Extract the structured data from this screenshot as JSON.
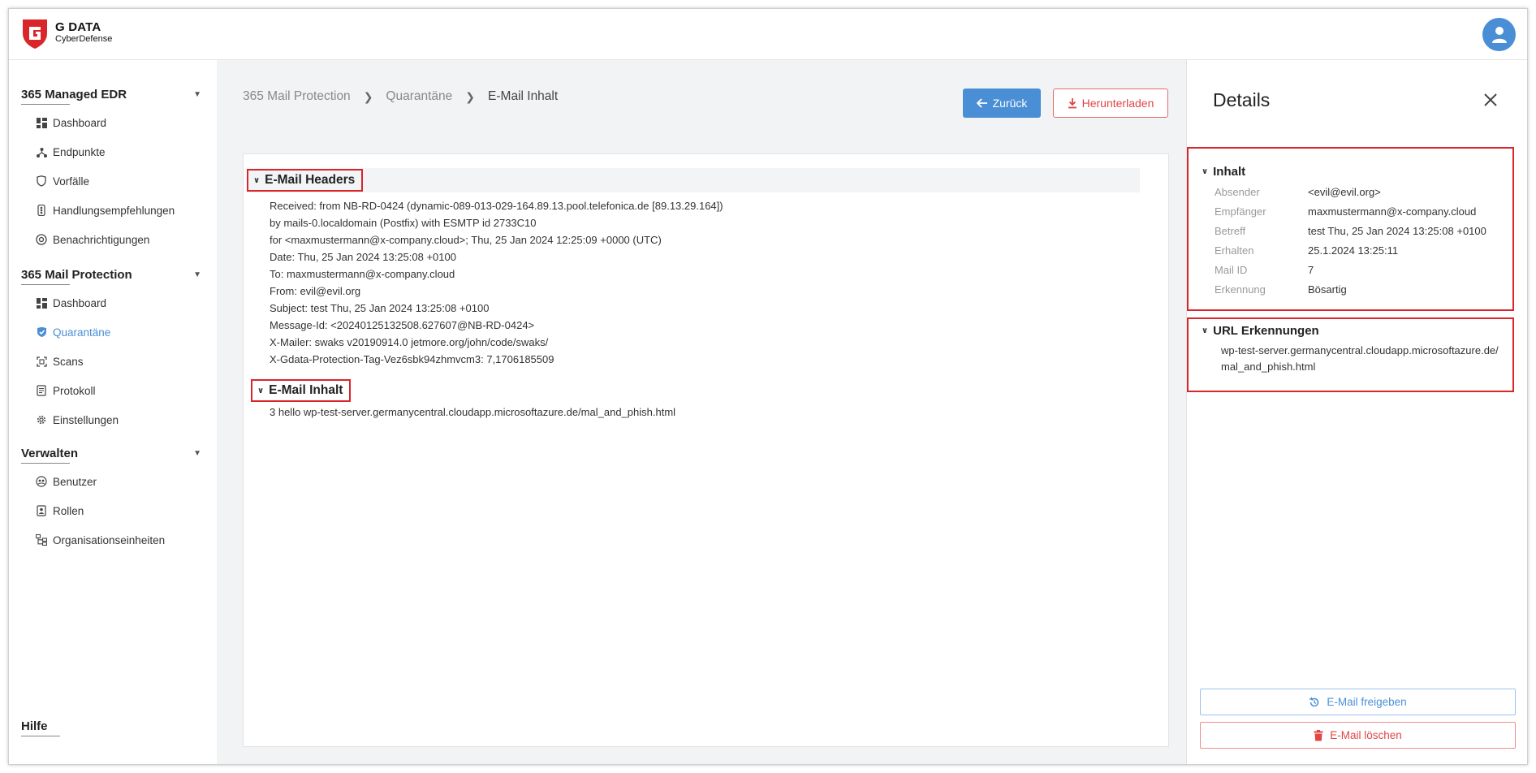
{
  "brand": {
    "name": "G DATA",
    "sub": "CyberDefense"
  },
  "sidebar": {
    "sections": [
      {
        "title": "365 Managed EDR",
        "items": [
          "Dashboard",
          "Endpunkte",
          "Vorfälle",
          "Handlungsempfehlungen",
          "Benachrichtigungen"
        ]
      },
      {
        "title": "365 Mail Protection",
        "items": [
          "Dashboard",
          "Quarantäne",
          "Scans",
          "Protokoll",
          "Einstellungen"
        ]
      },
      {
        "title": "Verwalten",
        "items": [
          "Benutzer",
          "Rollen",
          "Organisationseinheiten"
        ]
      }
    ],
    "active_item": "Quarantäne",
    "help": "Hilfe"
  },
  "breadcrumb": {
    "items": [
      "365 Mail Protection",
      "Quarantäne",
      "E-Mail Inhalt"
    ]
  },
  "actions": {
    "back": "Zurück",
    "download": "Herunterladen"
  },
  "email": {
    "headers_title": "E-Mail Headers",
    "headers": [
      "Received: from NB-RD-0424 (dynamic-089-013-029-164.89.13.pool.telefonica.de [89.13.29.164])",
      "by mails-0.localdomain (Postfix) with ESMTP id 2733C10",
      "for <maxmustermann@x-company.cloud>; Thu, 25 Jan 2024 12:25:09 +0000 (UTC)",
      "Date: Thu, 25 Jan 2024 13:25:08 +0100",
      "To: maxmustermann@x-company.cloud",
      "From: evil@evil.org",
      "Subject: test Thu, 25 Jan 2024 13:25:08 +0100",
      "Message-Id: <20240125132508.627607@NB-RD-0424>",
      "X-Mailer: swaks v20190914.0 jetmore.org/john/code/swaks/",
      "X-Gdata-Protection-Tag-Vez6sbk94zhmvcm3: 7,1706185509"
    ],
    "content_title": "E-Mail Inhalt",
    "content": "3 hello wp-test-server.germanycentral.cloudapp.microsoftazure.de/mal_and_phish.html"
  },
  "details": {
    "title": "Details",
    "inhalt": {
      "title": "Inhalt",
      "rows": [
        {
          "k": "Absender",
          "v": "<evil@evil.org>"
        },
        {
          "k": "Empfänger",
          "v": "maxmustermann@x-company.cloud"
        },
        {
          "k": "Betreff",
          "v": "test Thu, 25 Jan 2024 13:25:08 +0100"
        },
        {
          "k": "Erhalten",
          "v": "25.1.2024 13:25:11"
        },
        {
          "k": "Mail ID",
          "v": "7"
        },
        {
          "k": "Erkennung",
          "v": "Bösartig"
        }
      ]
    },
    "url": {
      "title": "URL Erkennungen",
      "value": "wp-test-server.germanycentral.cloudapp.microsoftazure.de/mal_and_phish.html"
    },
    "release": "E-Mail freigeben",
    "delete": "E-Mail löschen"
  },
  "colors": {
    "accent": "#4a8fd6",
    "danger": "#e04646",
    "highlight": "#d9262b"
  }
}
